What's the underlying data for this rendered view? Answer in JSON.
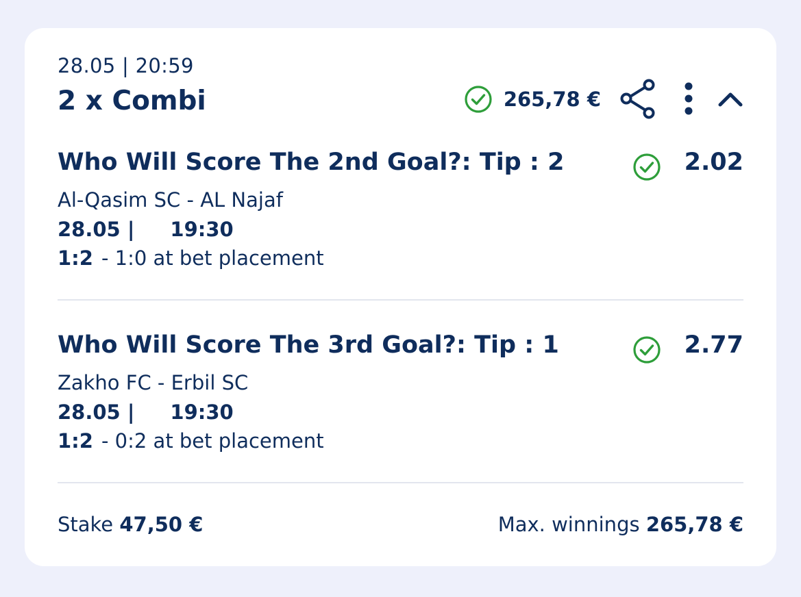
{
  "header": {
    "date_time": "28.05 | 20:59",
    "bet_type": "2 x Combi",
    "amount": "265,78 €"
  },
  "selections": [
    {
      "title": "Who Will Score The 2nd Goal?: Tip : 2",
      "odds": "2.02",
      "match": "Al-Qasim SC - AL Najaf",
      "date": "28.05 |",
      "time": "19:30",
      "final_score": "1:2",
      "placement_text": "- 1:0 at bet placement",
      "status": "won"
    },
    {
      "title": "Who Will Score The 3rd Goal?: Tip : 1",
      "odds": "2.77",
      "match": "Zakho FC - Erbil SC",
      "date": "28.05 |",
      "time": "19:30",
      "final_score": "1:2",
      "placement_text": "- 0:2 at bet placement",
      "status": "won"
    }
  ],
  "footer": {
    "stake_label": "Stake",
    "stake_value": "47,50 €",
    "max_label": "Max. winnings",
    "max_value": "265,78 €"
  },
  "colors": {
    "primary": "#0f2d5c",
    "success": "#2e9e3a",
    "background": "#eef0fb",
    "card": "#ffffff",
    "divider": "#e2e5ee"
  },
  "icons": {
    "status": "check-circle-icon",
    "share": "share-icon",
    "menu": "more-vertical-icon",
    "collapse": "chevron-up-icon"
  }
}
